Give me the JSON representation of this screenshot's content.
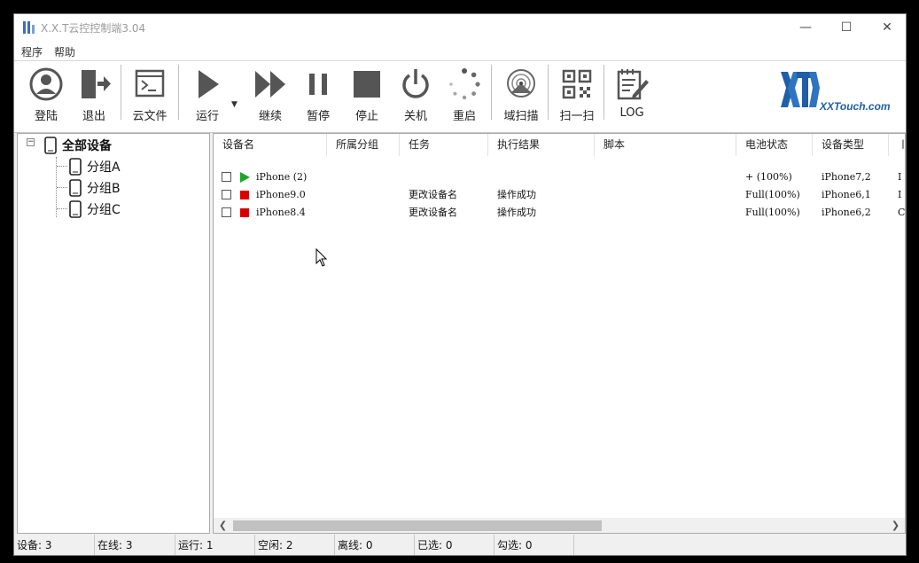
{
  "window": {
    "title": "X.X.T云控控制端3.04"
  },
  "menu": [
    "程序",
    "帮助"
  ],
  "toolbar": {
    "login": "登陆",
    "logout": "退出",
    "cloud_files": "云文件",
    "run": "运行",
    "resume": "继续",
    "pause": "暂停",
    "stop": "停止",
    "shutdown": "关机",
    "restart": "重启",
    "domain_scan": "域扫描",
    "scan_qr": "扫一扫",
    "log": "LOG"
  },
  "logo": {
    "text": "XXTouch.com",
    "color": "#1e5fa8"
  },
  "tree": {
    "root": "全部设备",
    "groups": [
      "分组A",
      "分组B",
      "分组C"
    ]
  },
  "table": {
    "columns": [
      "设备名",
      "所属分组",
      "任务",
      "执行结果",
      "脚本",
      "电池状态",
      "设备类型",
      "〡"
    ],
    "rows": [
      {
        "status": "running",
        "name": "iPhone (2)",
        "group": "",
        "task": "",
        "result": "",
        "script": "",
        "battery": "+ (100%)",
        "type": "iPhone7,2",
        "extra": "I"
      },
      {
        "status": "stopped",
        "name": "iPhone9.0",
        "group": "",
        "task": "更改设备名",
        "result": "操作成功",
        "script": "",
        "battery": "Full(100%)",
        "type": "iPhone6,1",
        "extra": "I"
      },
      {
        "status": "stopped",
        "name": "iPhone8.4",
        "group": "",
        "task": "更改设备名",
        "result": "操作成功",
        "script": "",
        "battery": "Full(100%)",
        "type": "iPhone6,2",
        "extra": "C"
      }
    ]
  },
  "statusbar": [
    "设备: 3",
    "在线: 3",
    "运行: 1",
    "空闲: 2",
    "离线: 0",
    "已选: 0",
    "勾选: 0"
  ],
  "colors": {
    "running": "#1fa32b",
    "stopped": "#d90000",
    "icon_gray": "#555555"
  }
}
